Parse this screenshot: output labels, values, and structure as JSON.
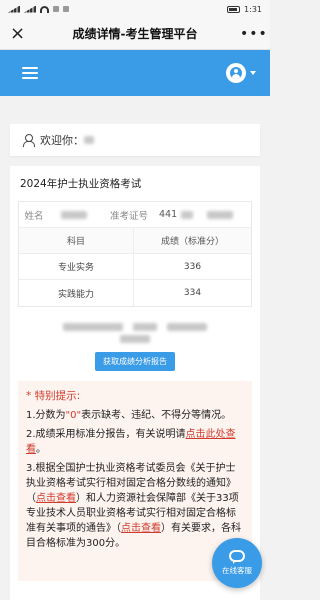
{
  "status": {
    "time": "1:31"
  },
  "titlebar": {
    "close_icon": "×",
    "title": "成绩详情-考生管理平台",
    "more_icon": "•••"
  },
  "header": {
    "menu_icon": "hamburger-icon",
    "user_icon": "user-avatar-icon"
  },
  "welcome": {
    "label": "欢迎你："
  },
  "exam": {
    "title": "2024年护士执业资格考试"
  },
  "info": {
    "name_label": "姓名",
    "id_label": "准考证号",
    "id_prefix": "441"
  },
  "grades": {
    "header": [
      "科目",
      "成绩（标准分）"
    ],
    "rows": [
      {
        "subject": "专业实务",
        "score": "336"
      },
      {
        "subject": "实践能力",
        "score": "334"
      }
    ]
  },
  "analyze_button": "获取成绩分析报告",
  "notice": {
    "title": "* 特别提示:",
    "p1_a": "1.分数为",
    "p1_quote": "\"0\"",
    "p1_b": "表示缺考、违纪、不得分等情况。",
    "p2_a": "2.成绩采用标准分报告，有关说明请",
    "p2_link": "点击此处查看",
    "p2_b": "。",
    "p3_a": "3.根据全国护士执业资格考试委员会《关于护士执业资格考试实行相对固定合格分数线的通知》（",
    "p3_link1": "点击查看",
    "p3_b": "）和人力资源社会保障部《关于33项专业技术人员职业资格考试实行相对固定合格标准有关事项的通告》（",
    "p3_link2": "点击查看",
    "p3_c": "）有关要求，各科目合格标准为300分。"
  },
  "service": {
    "label": "在线客服"
  },
  "colors": {
    "primary": "#3a9be6",
    "alert": "#d03b2d",
    "notice_bg": "#fdf3ef"
  }
}
